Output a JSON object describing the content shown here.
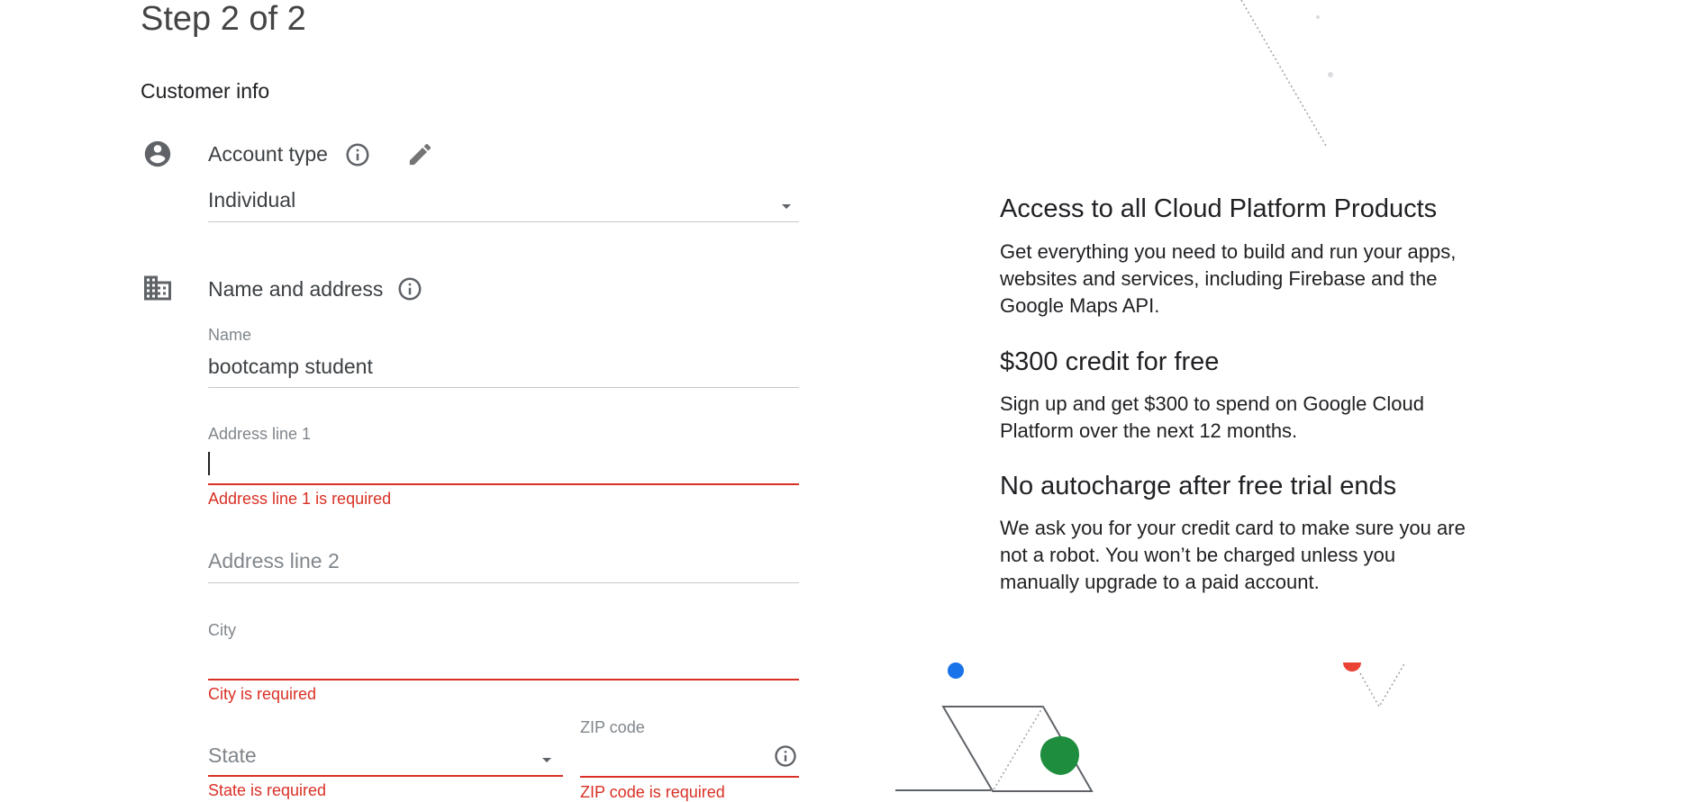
{
  "form": {
    "step_title": "Step 2 of 2",
    "section_title": "Customer info",
    "account_type": {
      "label": "Account type",
      "selected": "Individual"
    },
    "name_address": {
      "label": "Name and address",
      "name_label": "Name",
      "name_value": "bootcamp student",
      "address1_label": "Address line 1",
      "address1_value": "",
      "address1_error": "Address line 1 is required",
      "address2_placeholder": "Address line 2",
      "city_label": "City",
      "city_value": "",
      "city_error": "City is required",
      "state_placeholder": "State",
      "state_error": "State is required",
      "zip_label": "ZIP code",
      "zip_value": "",
      "zip_error": "ZIP code is required"
    }
  },
  "promo": {
    "h1": "Access to all Cloud Platform Products",
    "p1_line1": "Get everything you need to build and run your apps,",
    "p1_line2": "websites and services, including Firebase and the",
    "p1_line3": "Google Maps API.",
    "h2": "$300 credit for free",
    "p2_line1": "Sign up and get $300 to spend on Google Cloud",
    "p2_line2": "Platform over the next 12 months.",
    "h3": "No autocharge after free trial ends",
    "p3_line1": "We ask you for your credit card to make sure you are",
    "p3_line2": "not a robot. You won’t be charged unless you",
    "p3_line3": "manually upgrade to a paid account."
  },
  "colors": {
    "error": "#d93025",
    "blue_dot": "#1a73e8",
    "green_blob": "#1e8e3e",
    "red_dot": "#ea4335"
  },
  "icons": {
    "account": "account-circle-icon",
    "building": "business-icon",
    "info": "info-outline-icon",
    "edit": "pencil-icon",
    "dropdown": "arrow-drop-down-icon"
  }
}
